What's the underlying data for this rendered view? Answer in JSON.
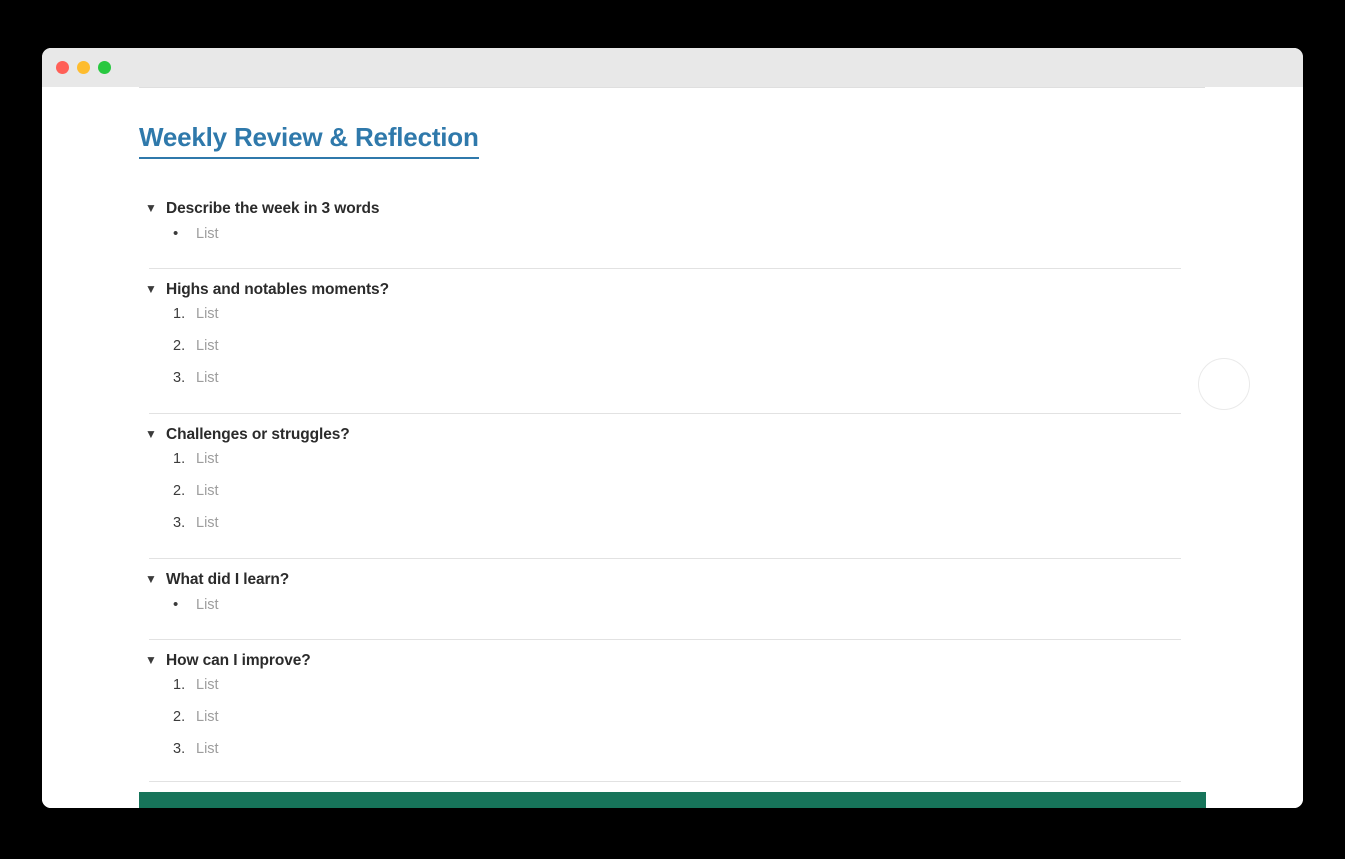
{
  "window": {
    "traffic_lights": [
      {
        "name": "close",
        "color": "#ff5f57"
      },
      {
        "name": "minimize",
        "color": "#febc2e"
      },
      {
        "name": "maximize",
        "color": "#28c840"
      }
    ],
    "titlebar_color": "#e8e8e8",
    "background_color": "#ffffff"
  },
  "document": {
    "title": "Weekly Review & Reflection",
    "title_color": "#2f79ab",
    "accent_bar_color": "#17745a",
    "divider_color": "#e2e2e2",
    "placeholder_text": "List",
    "caret_glyph": "▼",
    "bullet_glyph": "•",
    "sections": [
      {
        "title": "Describe the week in 3 words",
        "list_type": "bullet",
        "items": [
          {
            "marker": "•",
            "text": "List"
          }
        ]
      },
      {
        "title": "Highs and notables moments?",
        "list_type": "ordered",
        "items": [
          {
            "marker": "1.",
            "text": "List"
          },
          {
            "marker": "2.",
            "text": "List"
          },
          {
            "marker": "3.",
            "text": "List"
          }
        ]
      },
      {
        "title": "Challenges or struggles?",
        "list_type": "ordered",
        "items": [
          {
            "marker": "1.",
            "text": "List"
          },
          {
            "marker": "2.",
            "text": "List"
          },
          {
            "marker": "3.",
            "text": "List"
          }
        ]
      },
      {
        "title": "What did I learn?",
        "list_type": "bullet",
        "items": [
          {
            "marker": "•",
            "text": "List"
          }
        ]
      },
      {
        "title": "How can I improve?",
        "list_type": "ordered",
        "items": [
          {
            "marker": "1.",
            "text": "List"
          },
          {
            "marker": "2.",
            "text": "List"
          },
          {
            "marker": "3.",
            "text": "List"
          }
        ]
      }
    ]
  }
}
